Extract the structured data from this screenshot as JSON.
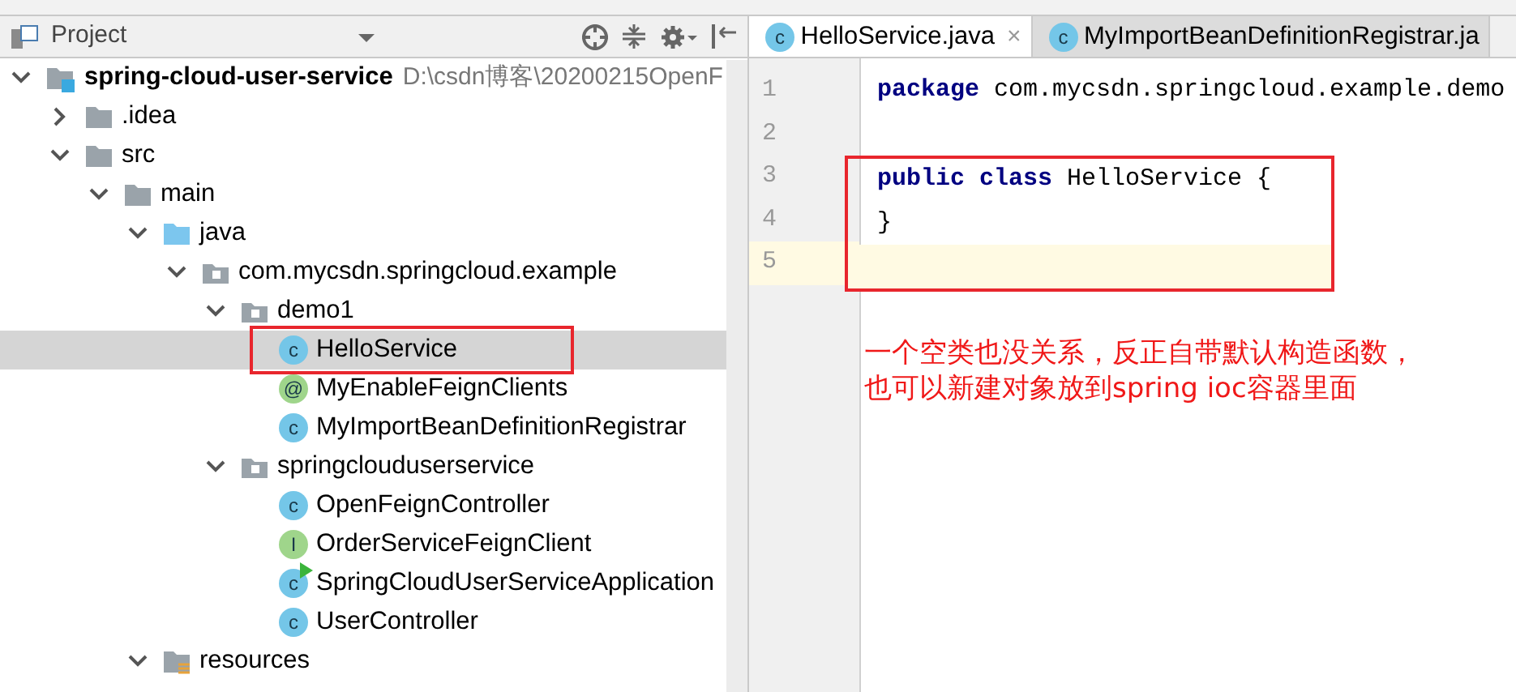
{
  "project_panel": {
    "title": "Project",
    "tree": [
      {
        "label": "spring-cloud-user-service",
        "path": "D:\\csdn博客\\20200215OpenF",
        "kind": "module",
        "expanded": true,
        "selected": false,
        "children": [
          {
            "label": ".idea",
            "kind": "folder",
            "expanded": false,
            "selected": false
          },
          {
            "label": "src",
            "kind": "folder",
            "expanded": true,
            "selected": false,
            "children": [
              {
                "label": "main",
                "kind": "folder",
                "expanded": true,
                "selected": false,
                "children": [
                  {
                    "label": "java",
                    "kind": "source",
                    "expanded": true,
                    "selected": false,
                    "children": [
                      {
                        "label": "com.mycsdn.springcloud.example",
                        "kind": "package",
                        "expanded": true,
                        "selected": false,
                        "children": [
                          {
                            "label": "demo1",
                            "kind": "package",
                            "expanded": true,
                            "selected": false,
                            "children": [
                              {
                                "label": "HelloService",
                                "kind": "class",
                                "badge": "c",
                                "selected": true,
                                "boxed": true
                              },
                              {
                                "label": "MyEnableFeignClients",
                                "kind": "annotation",
                                "badge": "@",
                                "selected": false,
                                "boxed": false
                              },
                              {
                                "label": "MyImportBeanDefinitionRegistrar",
                                "kind": "class",
                                "badge": "c",
                                "selected": false,
                                "boxed": false
                              }
                            ]
                          },
                          {
                            "label": "springclouduserservice",
                            "kind": "package",
                            "expanded": true,
                            "selected": false,
                            "children": [
                              {
                                "label": "OpenFeignController",
                                "kind": "class",
                                "badge": "c",
                                "selected": false,
                                "boxed": false
                              },
                              {
                                "label": "OrderServiceFeignClient",
                                "kind": "interface",
                                "badge": "I",
                                "selected": false,
                                "boxed": false
                              },
                              {
                                "label": "SpringCloudUserServiceApplication",
                                "kind": "app",
                                "badge": "c",
                                "selected": false,
                                "boxed": false
                              },
                              {
                                "label": "UserController",
                                "kind": "class",
                                "badge": "c",
                                "selected": false,
                                "boxed": false
                              }
                            ]
                          }
                        ]
                      }
                    ]
                  },
                  {
                    "label": "resources",
                    "kind": "resources",
                    "expanded": true,
                    "selected": false
                  }
                ]
              }
            ]
          }
        ]
      }
    ]
  },
  "editor": {
    "tabs": [
      {
        "label": "HelloService.java",
        "badge": "c",
        "selected": true,
        "close": "×"
      },
      {
        "label": "MyImportBeanDefinitionRegistrar.ja",
        "badge": "c",
        "selected": false
      }
    ],
    "lines": [
      {
        "number": "1",
        "current": false,
        "boxed": false,
        "tokens": [
          {
            "text": "package",
            "kind": "keyword"
          },
          {
            "text": " com.mycsdn.springcloud.example.demo",
            "kind": "plain"
          }
        ]
      },
      {
        "number": "2",
        "current": false,
        "boxed": false
      },
      {
        "number": "3",
        "current": false,
        "boxed": true,
        "tokens": [
          {
            "text": "public ",
            "kind": "keyword"
          },
          {
            "text": "class",
            "kind": "keyword"
          },
          {
            "text": " HelloService {",
            "kind": "plain"
          }
        ]
      },
      {
        "number": "4",
        "current": false,
        "boxed": true,
        "tokens": [
          {
            "text": "}",
            "kind": "plain"
          }
        ]
      },
      {
        "number": "5",
        "current": true,
        "boxed": true
      }
    ],
    "note": [
      "一个空类也没关系，反正自带默认构造函数，",
      "也可以新建对象放到spring ioc容器里面"
    ]
  }
}
